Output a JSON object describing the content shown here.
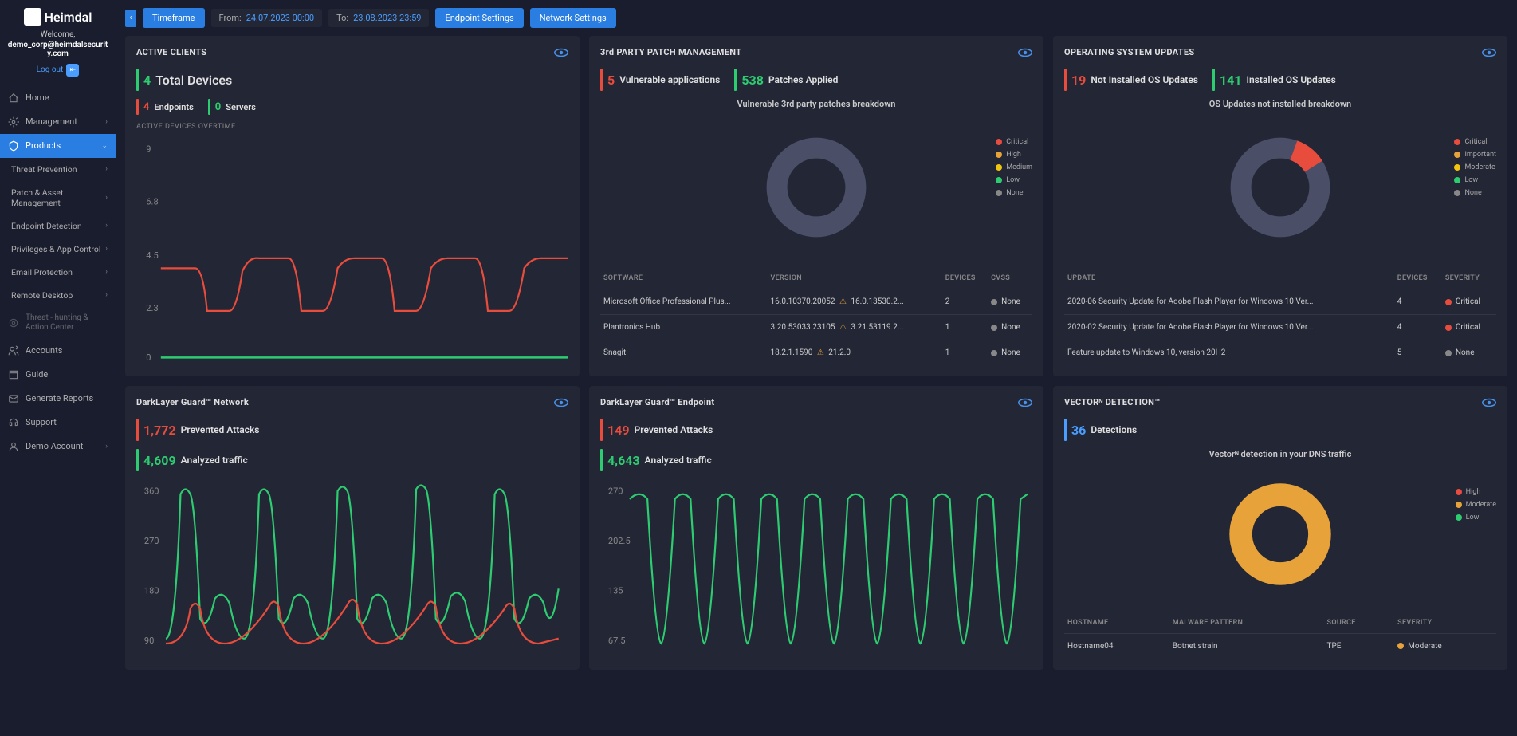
{
  "brand": {
    "name": "Heimdal",
    "welcome": "Welcome,",
    "user": "demo_corp@heimdalsecurity.com",
    "logout": "Log out"
  },
  "nav": {
    "home": "Home",
    "management": "Management",
    "products": "Products",
    "sub": {
      "threat_prev": "Threat Prevention",
      "patch_asset": "Patch & Asset Management",
      "endpoint_det": "Endpoint Detection",
      "priv_app": "Privileges & App Control",
      "email_prot": "Email Protection",
      "remote_desk": "Remote Desktop",
      "threat_hunt": "Threat - hunting & Action Center"
    },
    "accounts": "Accounts",
    "guide": "Guide",
    "gen_reports": "Generate Reports",
    "support": "Support",
    "demo_acct": "Demo Account"
  },
  "topbar": {
    "timeframe": "Timeframe",
    "from": "From:",
    "from_val": "24.07.2023 00:00",
    "to": "To:",
    "to_val": "23.08.2023 23:59",
    "endpoint_settings": "Endpoint Settings",
    "network_settings": "Network Settings"
  },
  "cards": {
    "active_clients": {
      "title": "ACTIVE CLIENTS",
      "total_devices_num": "4",
      "total_devices_lbl": "Total Devices",
      "endpoints_num": "4",
      "endpoints_lbl": "Endpoints",
      "servers_num": "0",
      "servers_lbl": "Servers",
      "subhead": "ACTIVE DEVICES OVERTIME"
    },
    "patch_mgmt": {
      "title": "3rd PARTY PATCH MANAGEMENT",
      "vuln_num": "5",
      "vuln_lbl": "Vulnerable applications",
      "patches_num": "538",
      "patches_lbl": "Patches Applied",
      "donut_title": "Vulnerable 3rd party patches breakdown",
      "th": {
        "software": "SOFTWARE",
        "version": "VERSION",
        "devices": "DEVICES",
        "cvss": "CVSS"
      },
      "rows": [
        {
          "software": "Microsoft Office Professional Plus...",
          "v1": "16.0.10370.20052",
          "v2": "16.0.13530.2...",
          "devices": "2",
          "cvss": "None"
        },
        {
          "software": "Plantronics Hub",
          "v1": "3.20.53033.23105",
          "v2": "3.21.53119.2...",
          "devices": "1",
          "cvss": "None"
        },
        {
          "software": "Snagit",
          "v1": "18.2.1.1590",
          "v2": "21.2.0",
          "devices": "1",
          "cvss": "None"
        }
      ]
    },
    "os_updates": {
      "title": "OPERATING SYSTEM UPDATES",
      "not_inst_num": "19",
      "not_inst_lbl": "Not Installed OS Updates",
      "inst_num": "141",
      "inst_lbl": "Installed OS Updates",
      "donut_title": "OS Updates not installed breakdown",
      "th": {
        "update": "UPDATE",
        "devices": "DEVICES",
        "severity": "SEVERITY"
      },
      "rows": [
        {
          "update": "2020-06 Security Update for Adobe Flash Player for Windows 10 Ver...",
          "devices": "4",
          "severity": "Critical"
        },
        {
          "update": "2020-02 Security Update for Adobe Flash Player for Windows 10 Ver...",
          "devices": "4",
          "severity": "Critical"
        },
        {
          "update": "Feature update to Windows 10, version 20H2",
          "devices": "5",
          "severity": "None"
        }
      ]
    },
    "dlg_network": {
      "title": "DarkLayer Guard™ Network",
      "prevented_num": "1,772",
      "prevented_lbl": "Prevented Attacks",
      "analyzed_num": "4,609",
      "analyzed_lbl": "Analyzed traffic"
    },
    "dlg_endpoint": {
      "title": "DarkLayer Guard™ Endpoint",
      "prevented_num": "149",
      "prevented_lbl": "Prevented Attacks",
      "analyzed_num": "4,643",
      "analyzed_lbl": "Analyzed traffic"
    },
    "vectorn": {
      "title": "VECTORᴺ DETECTION™",
      "det_num": "36",
      "det_lbl": "Detections",
      "donut_title": "Vectorᴺ detection in your DNS traffic",
      "th": {
        "hostname": "HOSTNAME",
        "malware": "MALWARE PATTERN",
        "source": "SOURCE",
        "severity": "SEVERITY"
      },
      "rows": [
        {
          "hostname": "Hostname04",
          "malware": "Botnet strain",
          "source": "TPE",
          "severity": "Moderate"
        }
      ]
    }
  },
  "legends": {
    "patch": [
      "Critical",
      "High",
      "Medium",
      "Low",
      "None"
    ],
    "os": [
      "Critical",
      "Important",
      "Moderate",
      "Low",
      "None"
    ],
    "vectorn": [
      "High",
      "Moderate",
      "Low"
    ]
  },
  "chart_data": [
    {
      "type": "line",
      "title": "Active devices overtime",
      "ylim": [
        0,
        9
      ],
      "yticks": [
        0,
        2.3,
        4.5,
        6.8,
        9
      ],
      "series": [
        {
          "name": "devices",
          "color": "#e74c3c",
          "values": [
            4,
            2.5,
            2.5,
            4,
            4,
            2.5,
            2.5,
            4,
            4,
            2.5,
            2.5,
            4,
            4,
            2.5,
            2.5,
            4,
            4,
            4,
            4
          ]
        }
      ],
      "baseline": {
        "color": "#2ecc71",
        "value": 0
      }
    },
    {
      "type": "donut",
      "title": "Vulnerable 3rd party patches breakdown",
      "values": [
        {
          "name": "None",
          "value": 5,
          "color": "#4a4e66"
        }
      ]
    },
    {
      "type": "donut",
      "title": "OS Updates not installed breakdown",
      "values": [
        {
          "name": "Critical",
          "value": 2,
          "color": "#e74c3c"
        },
        {
          "name": "None",
          "value": 17,
          "color": "#4a4e66"
        }
      ]
    },
    {
      "type": "line",
      "title": "DarkLayer Guard Network",
      "ylim": [
        90,
        360
      ],
      "yticks": [
        90,
        180,
        270,
        360
      ],
      "series": [
        {
          "name": "analyzed",
          "color": "#2ecc71",
          "values": [
            100,
            340,
            140,
            160,
            100,
            340,
            130,
            160,
            95,
            345,
            135,
            160,
            100,
            350,
            130,
            150,
            100,
            340
          ]
        },
        {
          "name": "prevented",
          "color": "#e74c3c",
          "values": [
            95,
            120,
            100,
            95,
            95,
            125,
            100,
            95,
            92,
            130,
            100,
            95,
            95,
            125,
            100,
            95,
            95,
            120
          ]
        }
      ]
    },
    {
      "type": "line",
      "title": "DarkLayer Guard Endpoint",
      "ylim": [
        67.5,
        270
      ],
      "yticks": [
        67.5,
        135,
        202.5,
        270
      ],
      "series": [
        {
          "name": "analyzed",
          "color": "#2ecc71",
          "values": [
            260,
            80,
            260,
            80,
            260,
            80,
            260,
            80,
            260,
            80,
            260,
            80,
            260,
            80,
            260,
            80,
            260,
            80,
            260
          ]
        }
      ]
    },
    {
      "type": "donut",
      "title": "VectorN detection",
      "values": [
        {
          "name": "Moderate",
          "value": 36,
          "color": "#e8a23a"
        }
      ]
    }
  ]
}
